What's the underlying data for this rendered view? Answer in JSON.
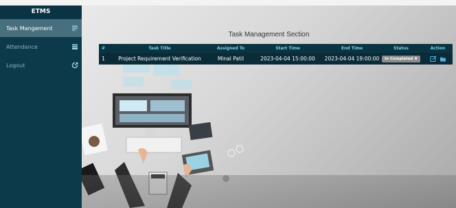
{
  "sidebar": {
    "brand": "ETMS",
    "items": [
      {
        "label": "Task Mangement",
        "icon": "list-icon",
        "active": true
      },
      {
        "label": "Attendance",
        "icon": "calendar-icon",
        "active": false
      },
      {
        "label": "Logout",
        "icon": "logout-icon",
        "active": false
      }
    ]
  },
  "main": {
    "title": "Task Management Section",
    "table": {
      "headers": [
        "#",
        "Task Title",
        "Assigned To",
        "Start Time",
        "End Time",
        "Status",
        "Action"
      ],
      "rows": [
        {
          "num": "1",
          "title": "Project Requirement Verification",
          "assigned_to": "Minal Patil",
          "start": "2023-04-04 15:00:00",
          "end": "2023-04-04 19:00:00",
          "status": "In Completed ✖",
          "actions": [
            "edit-icon",
            "folder-icon"
          ]
        }
      ]
    }
  },
  "colors": {
    "sidebar": "#0c3a4b",
    "active_item": "#486f7d",
    "table_header_text": "#7fd1ee",
    "action_icon": "#4fb3e6"
  }
}
